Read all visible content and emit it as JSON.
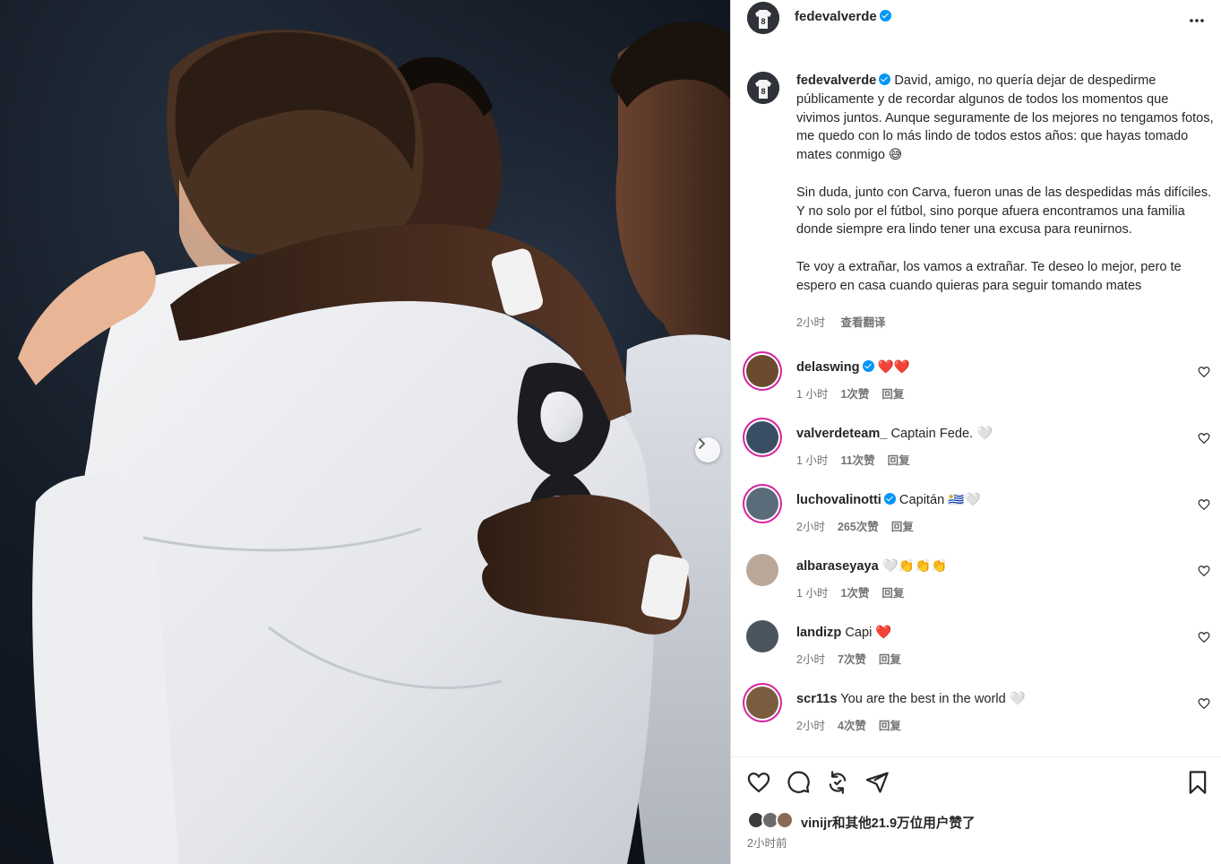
{
  "post": {
    "username": "fedevalverde",
    "verified": true,
    "avatar_jersey_number": "8",
    "caption_paragraphs": [
      "David, amigo, no quería dejar de despedirme públicamente y de recordar algunos de todos los momentos que vivimos juntos. Aunque seguramente de los mejores no tengamos fotos, me quedo con lo más lindo de todos estos años: que hayas tomado mates conmigo 😅",
      "Sin duda, junto con Carva, fueron unas de las despedidas más difíciles. Y no solo por el fútbol, sino porque afuera encontramos una familia donde siempre era lindo tener una excusa para reunirnos.",
      "Te voy a extrañar, los vamos a extrañar. Te deseo lo mejor, pero te espero en casa cuando quieras para seguir tomando mates"
    ],
    "caption_time": "2小时",
    "translate_label": "查看翻译",
    "more_icon": "more-horizontal-icon"
  },
  "comments": [
    {
      "username": "delaswing",
      "verified": true,
      "text": "❤️❤️",
      "time": "1 小时",
      "likes": "1次赞",
      "reply": "回复",
      "avatar_color": "#6b4a2e"
    },
    {
      "username": "valverdeteam_",
      "verified": false,
      "text": "Captain Fede. 🤍",
      "time": "1 小时",
      "likes": "11次赞",
      "reply": "回复",
      "avatar_color": "#3a4e63"
    },
    {
      "username": "luchovalinotti",
      "verified": true,
      "text": "Capitán 🇺🇾🤍",
      "time": "2小时",
      "likes": "265次赞",
      "reply": "回复",
      "avatar_color": "#5a6b7a"
    },
    {
      "username": "albaraseyaya",
      "verified": false,
      "text": "🤍👏👏👏",
      "time": "1 小时",
      "likes": "1次赞",
      "reply": "回复",
      "avatar_color": "#b9a89a"
    },
    {
      "username": "landizp",
      "verified": false,
      "text": "Capi ❤️",
      "time": "2小时",
      "likes": "7次赞",
      "reply": "回复",
      "avatar_color": "#4b5560"
    },
    {
      "username": "scr11s",
      "verified": false,
      "text": "You are the best in the world 🤍",
      "time": "2小时",
      "likes": "4次赞",
      "reply": "回复",
      "avatar_color": "#7a5c3e"
    }
  ],
  "actions": {
    "like_icon": "heart-icon",
    "comment_icon": "comment-icon",
    "share_icon": "repost-icon",
    "send_icon": "send-icon",
    "save_icon": "bookmark-icon"
  },
  "likes": {
    "first_user": "vinijr",
    "rest_text": "和其他21.9万位用户赞了"
  },
  "post_time": "2小时前",
  "colors": {
    "link_blue": "#0095f6",
    "text_primary": "#262626",
    "text_secondary": "#737373",
    "story_ring": "#d6249f"
  }
}
